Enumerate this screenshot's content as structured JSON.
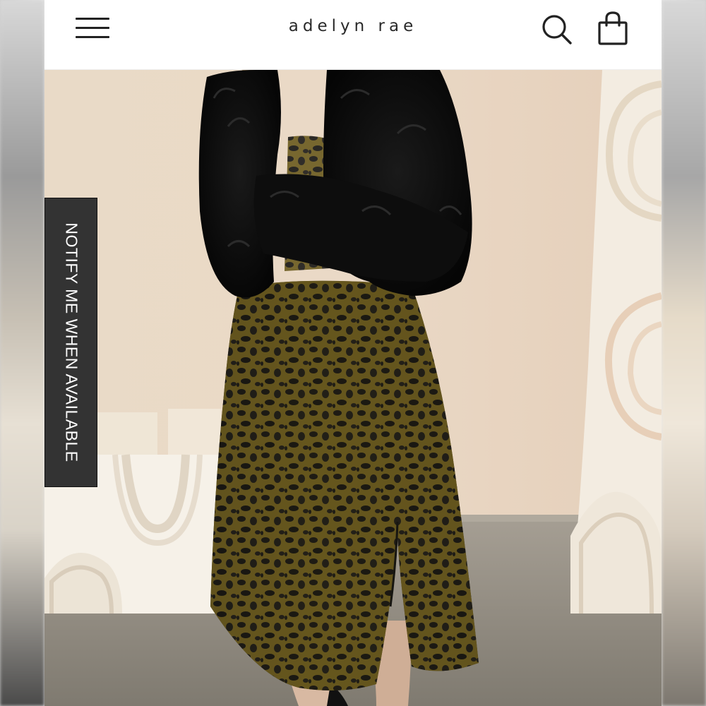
{
  "header": {
    "brand": "adelyn rae",
    "menu_icon": "hamburger-menu-icon",
    "search_icon": "search-icon",
    "bag_icon": "shopping-bag-icon"
  },
  "product_image": {
    "icon": "product-photo"
  },
  "notify_tab": {
    "label": "NOTIFY ME WHEN AVAILABLE"
  },
  "colors": {
    "header_bg": "#ffffff",
    "text": "#222222",
    "notify_bg": "#333333",
    "notify_text": "#ffffff"
  }
}
